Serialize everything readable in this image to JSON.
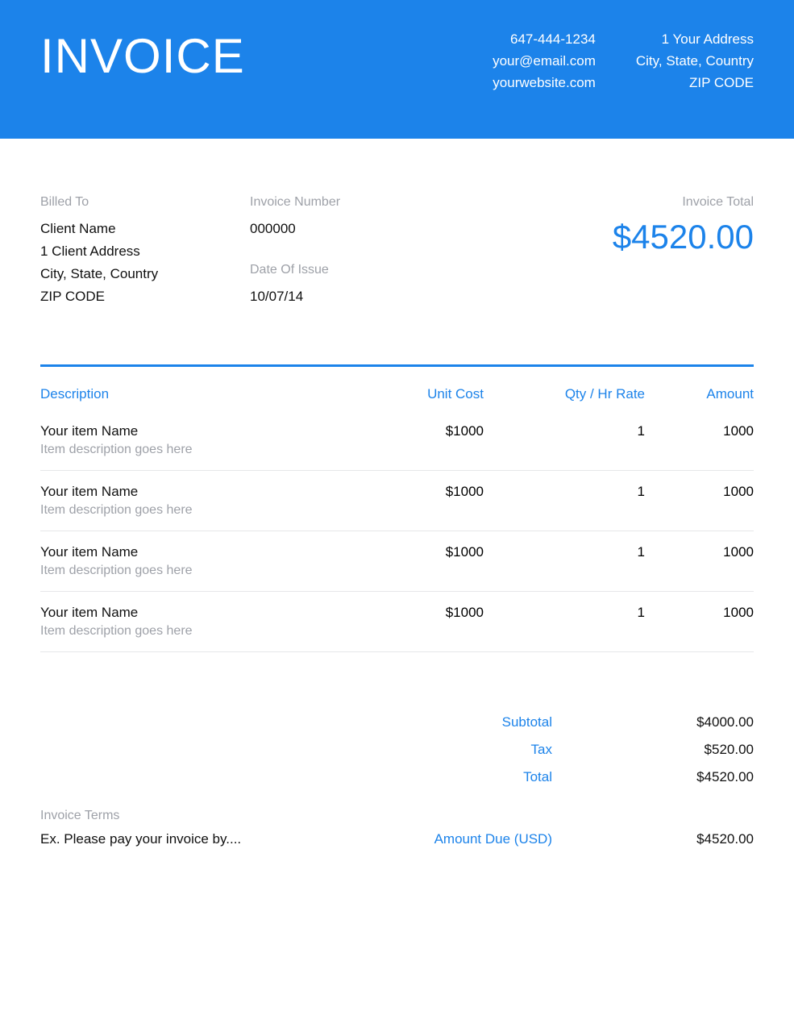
{
  "header": {
    "title": "INVOICE",
    "contact": {
      "phone": "647-444-1234",
      "email": "your@email.com",
      "website": "yourwebsite.com"
    },
    "address": {
      "line1": "1 Your Address",
      "line2": "City, State, Country",
      "zip": "ZIP CODE"
    }
  },
  "billed": {
    "label": "Billed To",
    "name": "Client Name",
    "addr1": "1 Client Address",
    "addr2": "City, State, Country",
    "zip": "ZIP CODE"
  },
  "invoice_number": {
    "label": "Invoice Number",
    "value": "000000"
  },
  "date_of_issue": {
    "label": "Date Of Issue",
    "value": "10/07/14"
  },
  "invoice_total": {
    "label": "Invoice Total",
    "value": "$4520.00"
  },
  "columns": {
    "description": "Description",
    "unit_cost": "Unit Cost",
    "qty": "Qty / Hr Rate",
    "amount": "Amount"
  },
  "items": [
    {
      "name": "Your item Name",
      "desc": "Item description goes here",
      "unit": "$1000",
      "qty": "1",
      "amount": "1000"
    },
    {
      "name": "Your item Name",
      "desc": "Item description goes here",
      "unit": "$1000",
      "qty": "1",
      "amount": "1000"
    },
    {
      "name": "Your item Name",
      "desc": "Item description goes here",
      "unit": "$1000",
      "qty": "1",
      "amount": "1000"
    },
    {
      "name": "Your item Name",
      "desc": "Item description goes here",
      "unit": "$1000",
      "qty": "1",
      "amount": "1000"
    }
  ],
  "summary": {
    "subtotal": {
      "label": "Subtotal",
      "value": "$4000.00"
    },
    "tax": {
      "label": "Tax",
      "value": "$520.00"
    },
    "total": {
      "label": "Total",
      "value": "$4520.00"
    }
  },
  "terms": {
    "label": "Invoice Terms",
    "text": "Ex. Please pay your invoice by....",
    "due_label": "Amount Due (USD)",
    "due_value": "$4520.00"
  }
}
